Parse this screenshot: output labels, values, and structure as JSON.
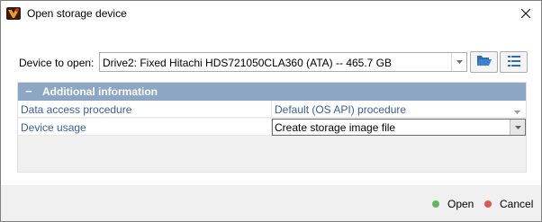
{
  "window": {
    "title": "Open storage device"
  },
  "device": {
    "label": "Device to open:",
    "value": "Drive2: Fixed Hitachi HDS721050CLA360 (ATA) -- 465.7 GB"
  },
  "panel": {
    "collapse_symbol": "−",
    "title": "Additional information",
    "rows": [
      {
        "key": "Data access procedure",
        "value": "Default (OS API) procedure"
      },
      {
        "key": "Device usage",
        "value": "Create storage image file"
      }
    ]
  },
  "footer": {
    "open_label": "Open",
    "cancel_label": "Cancel"
  },
  "colors": {
    "header_bg": "#8ca6c4",
    "open_dot": "#5fb85f",
    "cancel_dot": "#e05555",
    "link_text": "#3b5e9a"
  },
  "icons": {
    "app": "app-logo-icon",
    "close": "close-icon",
    "folder": "open-folder-icon",
    "list": "list-icon"
  }
}
